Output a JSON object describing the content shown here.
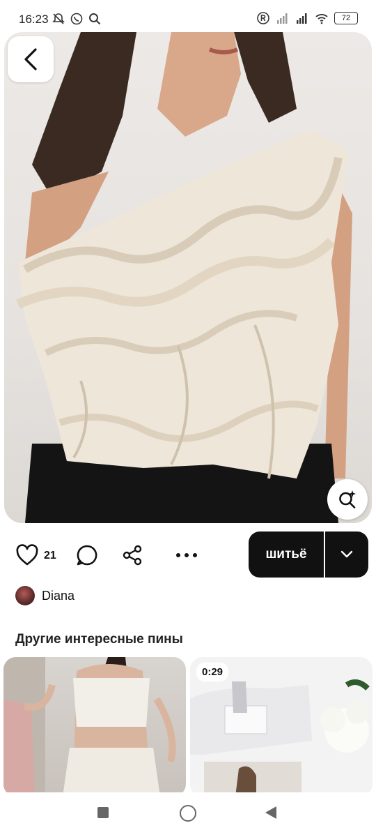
{
  "status": {
    "time": "16:23",
    "battery": "72",
    "left_icons": [
      "mute-bell-icon",
      "whatsapp-icon",
      "search-icon"
    ],
    "right_icons": [
      "registered-icon",
      "signal-icon",
      "signal-icon",
      "wifi-icon",
      "battery-icon"
    ]
  },
  "pin": {
    "like_count": "21",
    "board_button_label": "шитьё"
  },
  "author": {
    "name": "Diana"
  },
  "more_pins": {
    "title": "Другие интересные пины",
    "cards": [
      {
        "badge": ""
      },
      {
        "badge": "0:29"
      }
    ]
  }
}
